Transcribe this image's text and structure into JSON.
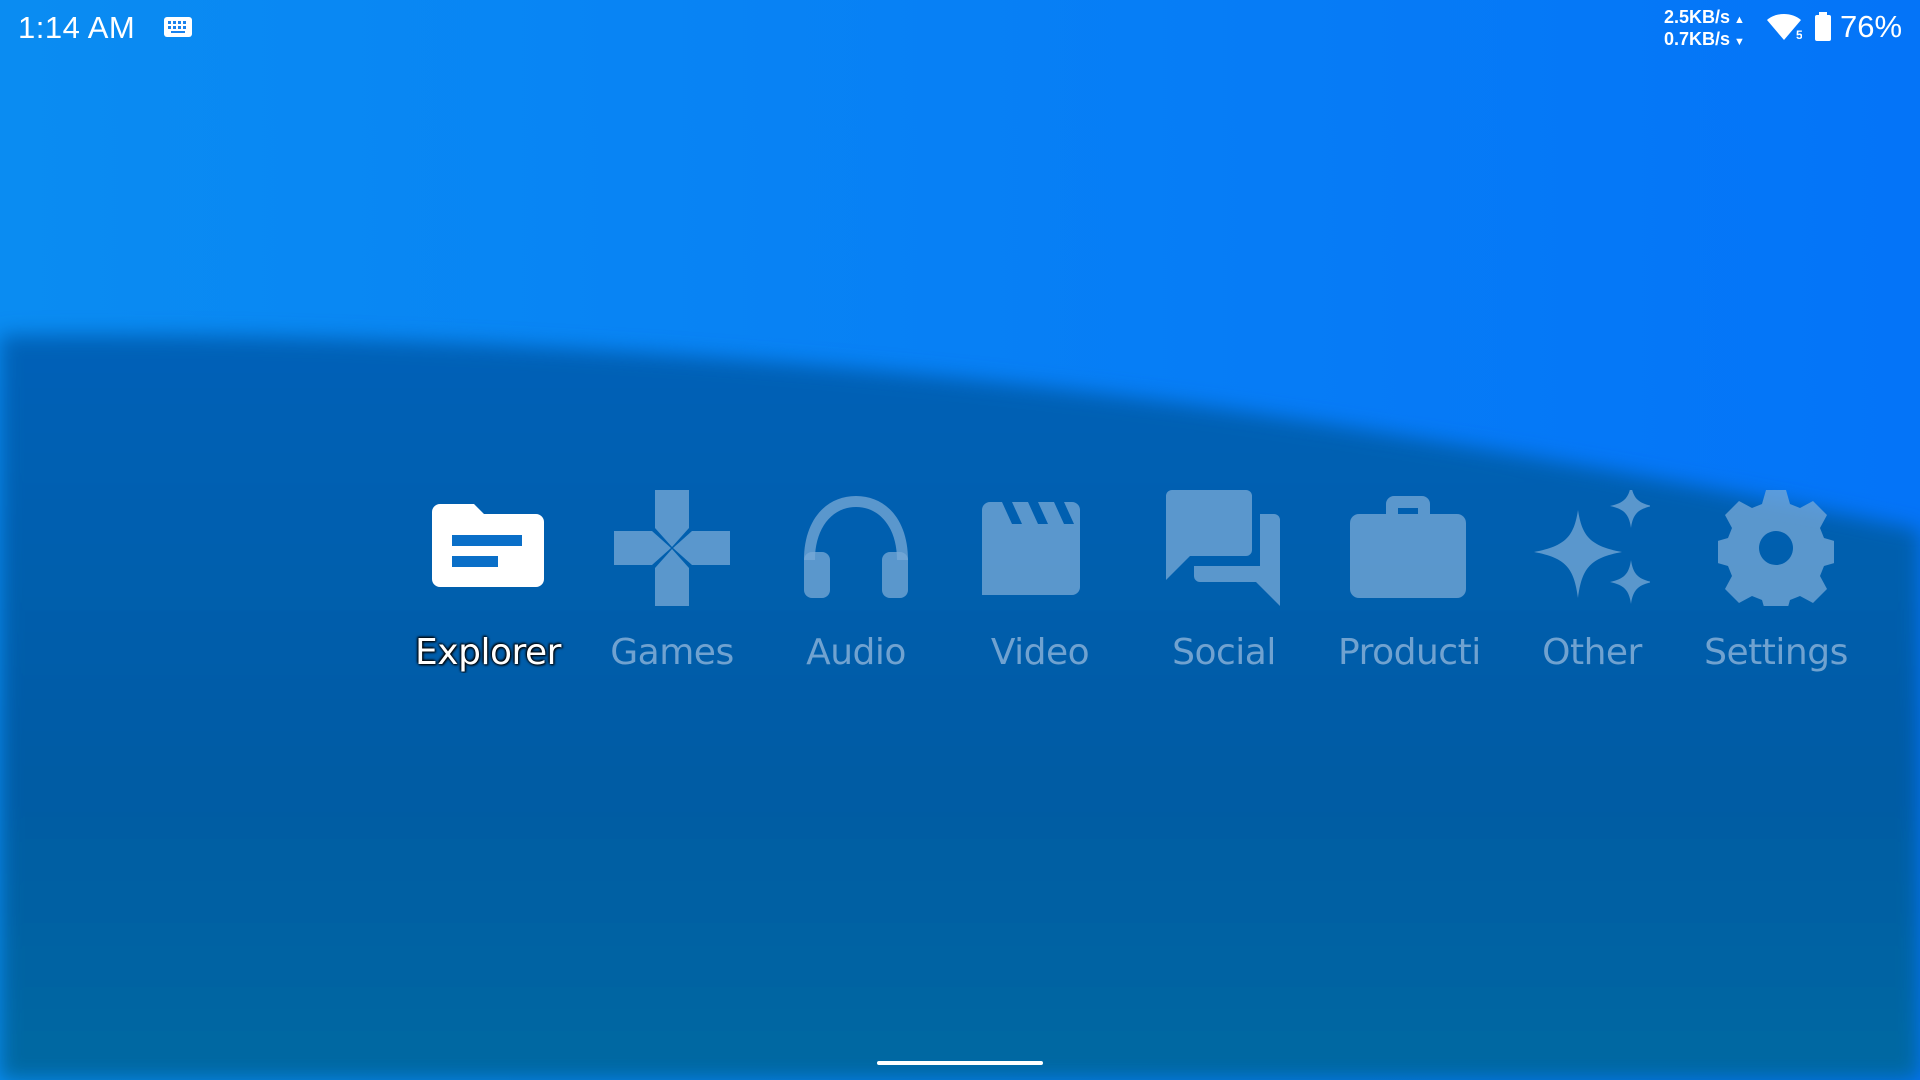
{
  "status_bar": {
    "time": "1:14 AM",
    "keyboard_icon": "keyboard-icon",
    "upload_speed": "2.5KB/s",
    "download_speed": "0.7KB/s",
    "upload_arrow": "▲",
    "download_arrow": "▼",
    "wifi_icon": "wifi-5-icon",
    "wifi_badge": "5",
    "battery_icon": "battery-icon",
    "battery_level": "76%"
  },
  "launcher": {
    "selected_index": 0,
    "items": [
      {
        "label": "Explorer",
        "icon": "folder-icon"
      },
      {
        "label": "Games",
        "icon": "gamepad-icon"
      },
      {
        "label": "Audio",
        "icon": "headphones-icon"
      },
      {
        "label": "Video",
        "icon": "clapperboard-icon"
      },
      {
        "label": "Social",
        "icon": "chat-bubbles-icon"
      },
      {
        "label": "Productivity",
        "icon": "briefcase-icon"
      },
      {
        "label": "Other",
        "icon": "sparkles-icon"
      },
      {
        "label": "Settings",
        "icon": "gear-icon"
      }
    ]
  },
  "colors": {
    "background_top": "#0a86f0",
    "background_bottom": "#005a9e",
    "selected_text": "#ffffff",
    "dim_icon": "#78aad7"
  }
}
